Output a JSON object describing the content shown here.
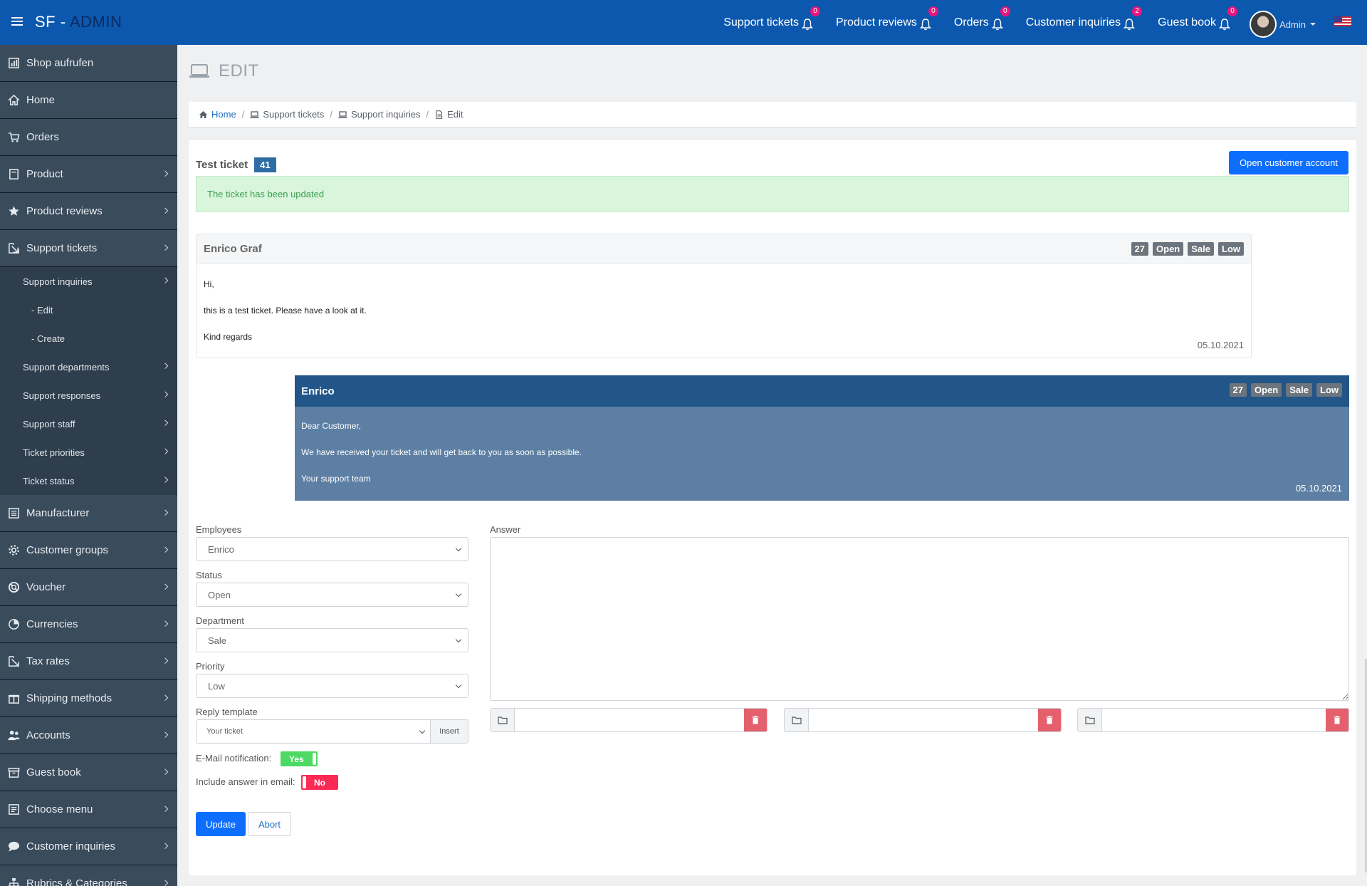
{
  "brand": {
    "part1": "SF - ",
    "part2": "ADMIN"
  },
  "topnav": [
    {
      "label": "Support tickets",
      "count": "0"
    },
    {
      "label": "Product reviews",
      "count": "0"
    },
    {
      "label": "Orders",
      "count": "0"
    },
    {
      "label": "Customer inquiries",
      "count": "2"
    },
    {
      "label": "Guest book",
      "count": "0"
    }
  ],
  "user": {
    "name": "Admin"
  },
  "sidebar": {
    "items": [
      {
        "label": "Shop aufrufen",
        "icon": "chart-icon",
        "chevron": false
      },
      {
        "label": "Home",
        "icon": "home-icon",
        "chevron": false
      },
      {
        "label": "Orders",
        "icon": "cart-icon",
        "chevron": false
      },
      {
        "label": "Product",
        "icon": "box-icon",
        "chevron": true
      },
      {
        "label": "Product reviews",
        "icon": "star-icon",
        "chevron": true
      },
      {
        "label": "Support tickets",
        "icon": "ticket-icon",
        "chevron": true
      }
    ],
    "subitems": [
      {
        "label": "Support inquiries",
        "deep": false,
        "chevron": true
      },
      {
        "label": "- Edit",
        "deep": true,
        "chevron": false
      },
      {
        "label": "- Create",
        "deep": true,
        "chevron": false
      },
      {
        "label": "Support departments",
        "deep": false,
        "chevron": true
      },
      {
        "label": "Support responses",
        "deep": false,
        "chevron": true
      },
      {
        "label": "Support staff",
        "deep": false,
        "chevron": true
      },
      {
        "label": "Ticket priorities",
        "deep": false,
        "chevron": true
      },
      {
        "label": "Ticket status",
        "deep": false,
        "chevron": true
      }
    ],
    "items2": [
      {
        "label": "Manufacturer",
        "icon": "list-icon"
      },
      {
        "label": "Customer groups",
        "icon": "gear-icon"
      },
      {
        "label": "Voucher",
        "icon": "lifebuoy-icon"
      },
      {
        "label": "Currencies",
        "icon": "pie-icon"
      },
      {
        "label": "Tax rates",
        "icon": "percent-icon"
      },
      {
        "label": "Shipping methods",
        "icon": "gift-icon"
      },
      {
        "label": "Accounts",
        "icon": "users-icon"
      },
      {
        "label": "Guest book",
        "icon": "archive-icon"
      },
      {
        "label": "Choose menu",
        "icon": "menu-list-icon"
      },
      {
        "label": "Customer inquiries",
        "icon": "chat-icon"
      },
      {
        "label": "Rubrics & Categories",
        "icon": "sitemap-icon"
      }
    ]
  },
  "page": {
    "title": "EDIT"
  },
  "breadcrumb": [
    "Home",
    "Support tickets",
    "Support inquiries",
    "Edit"
  ],
  "ticket": {
    "title": "Test ticket",
    "number": "41",
    "open_account_label": "Open customer account",
    "alert": "The ticket has been updated"
  },
  "messages": [
    {
      "author": "Enrico Graf",
      "tags": [
        "27",
        "Open",
        "Sale",
        "Low"
      ],
      "lines": [
        "Hi,",
        "this is a test ticket. Please have a look at it.",
        "Kind regards"
      ],
      "date": "05.10.2021"
    },
    {
      "author": "Enrico",
      "tags": [
        "27",
        "Open",
        "Sale",
        "Low"
      ],
      "lines": [
        "Dear Customer,",
        "We have received your ticket and will get back to you as soon as possible.",
        "Your support team"
      ],
      "date": "05.10.2021"
    }
  ],
  "form": {
    "employees_label": "Employees",
    "employees_value": "Enrico",
    "status_label": "Status",
    "status_value": "Open",
    "department_label": "Department",
    "department_value": "Sale",
    "priority_label": "Priority",
    "priority_value": "Low",
    "reply_label": "Reply template",
    "reply_value": "Your ticket",
    "insert_label": "Insert",
    "email_label": "E-Mail notification:",
    "email_value": "Yes",
    "include_label": "Include answer in email:",
    "include_value": "No",
    "answer_label": "Answer",
    "update_label": "Update",
    "abort_label": "Abort"
  }
}
